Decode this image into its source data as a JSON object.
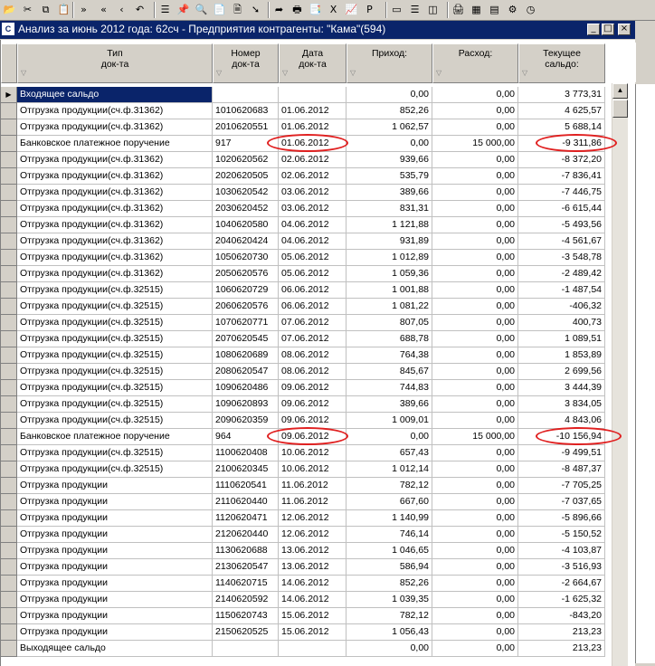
{
  "title": "Анализ за июнь 2012 года: 62сч - Предприятия контрагенты: \"Кама\"(594)",
  "toolbar": {
    "icons": [
      "open-icon",
      "cut-icon",
      "copy-icon",
      "paste-icon",
      "forward-icon",
      "back-icon",
      "back-step-icon",
      "undo-icon",
      "list-icon",
      "pin-icon",
      "print-preview-icon",
      "new-doc-icon",
      "doc-icon",
      "arrow-icon",
      "export-icon",
      "print-icon",
      "report-icon",
      "excel-icon",
      "excel-chart-icon",
      "pdf-icon",
      "window-icon",
      "split-h-icon",
      "split-v-icon",
      "printer-icon",
      "table-icon",
      "sheet-icon",
      "settings-icon",
      "clock-icon"
    ],
    "glyphs": [
      "📂",
      "✂",
      "⧉",
      "📋",
      "»",
      "«",
      "‹",
      "↶",
      "☰",
      "📌",
      "🔍",
      "📄",
      "🗎",
      "➘",
      "➦",
      "🖶",
      "📑",
      "X",
      "📈",
      "P",
      "▭",
      "☰",
      "◫",
      "🖨",
      "▦",
      "▤",
      "⚙",
      "◷"
    ]
  },
  "window_buttons": {
    "minimize": "_",
    "maximize": "□",
    "close": "×"
  },
  "columns": [
    {
      "name": "col-doc-type",
      "label": "Тип\nдок-та"
    },
    {
      "name": "col-doc-number",
      "label": "Номер\nдок-та"
    },
    {
      "name": "col-doc-date",
      "label": "Дата\nдок-та"
    },
    {
      "name": "col-income",
      "label": "Приход:"
    },
    {
      "name": "col-expense",
      "label": "Расход:"
    },
    {
      "name": "col-balance",
      "label": "Текущее\nсальдо:"
    }
  ],
  "rows": [
    [
      "Входящее сальдо",
      "",
      "",
      "0,00",
      "0,00",
      "3 773,31"
    ],
    [
      "Отгрузка продукции(сч.ф.31362)",
      "1010620683",
      "01.06.2012",
      "852,26",
      "0,00",
      "4 625,57"
    ],
    [
      "Отгрузка продукции(сч.ф.31362)",
      "2010620551",
      "01.06.2012",
      "1 062,57",
      "0,00",
      "5 688,14"
    ],
    [
      "Банковское платежное поручение",
      "917",
      "01.06.2012",
      "0,00",
      "15 000,00",
      "-9 311,86"
    ],
    [
      "Отгрузка продукции(сч.ф.31362)",
      "1020620562",
      "02.06.2012",
      "939,66",
      "0,00",
      "-8 372,20"
    ],
    [
      "Отгрузка продукции(сч.ф.31362)",
      "2020620505",
      "02.06.2012",
      "535,79",
      "0,00",
      "-7 836,41"
    ],
    [
      "Отгрузка продукции(сч.ф.31362)",
      "1030620542",
      "03.06.2012",
      "389,66",
      "0,00",
      "-7 446,75"
    ],
    [
      "Отгрузка продукции(сч.ф.31362)",
      "2030620452",
      "03.06.2012",
      "831,31",
      "0,00",
      "-6 615,44"
    ],
    [
      "Отгрузка продукции(сч.ф.31362)",
      "1040620580",
      "04.06.2012",
      "1 121,88",
      "0,00",
      "-5 493,56"
    ],
    [
      "Отгрузка продукции(сч.ф.31362)",
      "2040620424",
      "04.06.2012",
      "931,89",
      "0,00",
      "-4 561,67"
    ],
    [
      "Отгрузка продукции(сч.ф.31362)",
      "1050620730",
      "05.06.2012",
      "1 012,89",
      "0,00",
      "-3 548,78"
    ],
    [
      "Отгрузка продукции(сч.ф.31362)",
      "2050620576",
      "05.06.2012",
      "1 059,36",
      "0,00",
      "-2 489,42"
    ],
    [
      "Отгрузка продукции(сч.ф.32515)",
      "1060620729",
      "06.06.2012",
      "1 001,88",
      "0,00",
      "-1 487,54"
    ],
    [
      "Отгрузка продукции(сч.ф.32515)",
      "2060620576",
      "06.06.2012",
      "1 081,22",
      "0,00",
      "-406,32"
    ],
    [
      "Отгрузка продукции(сч.ф.32515)",
      "1070620771",
      "07.06.2012",
      "807,05",
      "0,00",
      "400,73"
    ],
    [
      "Отгрузка продукции(сч.ф.32515)",
      "2070620545",
      "07.06.2012",
      "688,78",
      "0,00",
      "1 089,51"
    ],
    [
      "Отгрузка продукции(сч.ф.32515)",
      "1080620689",
      "08.06.2012",
      "764,38",
      "0,00",
      "1 853,89"
    ],
    [
      "Отгрузка продукции(сч.ф.32515)",
      "2080620547",
      "08.06.2012",
      "845,67",
      "0,00",
      "2 699,56"
    ],
    [
      "Отгрузка продукции(сч.ф.32515)",
      "1090620486",
      "09.06.2012",
      "744,83",
      "0,00",
      "3 444,39"
    ],
    [
      "Отгрузка продукции(сч.ф.32515)",
      "1090620893",
      "09.06.2012",
      "389,66",
      "0,00",
      "3 834,05"
    ],
    [
      "Отгрузка продукции(сч.ф.32515)",
      "2090620359",
      "09.06.2012",
      "1 009,01",
      "0,00",
      "4 843,06"
    ],
    [
      "Банковское платежное поручение",
      "964",
      "09.06.2012",
      "0,00",
      "15 000,00",
      "-10 156,94"
    ],
    [
      "Отгрузка продукции(сч.ф.32515)",
      "1100620408",
      "10.06.2012",
      "657,43",
      "0,00",
      "-9 499,51"
    ],
    [
      "Отгрузка продукции(сч.ф.32515)",
      "2100620345",
      "10.06.2012",
      "1 012,14",
      "0,00",
      "-8 487,37"
    ],
    [
      "Отгрузка продукции",
      "1110620541",
      "11.06.2012",
      "782,12",
      "0,00",
      "-7 705,25"
    ],
    [
      "Отгрузка продукции",
      "2110620440",
      "11.06.2012",
      "667,60",
      "0,00",
      "-7 037,65"
    ],
    [
      "Отгрузка продукции",
      "1120620471",
      "12.06.2012",
      "1 140,99",
      "0,00",
      "-5 896,66"
    ],
    [
      "Отгрузка продукции",
      "2120620440",
      "12.06.2012",
      "746,14",
      "0,00",
      "-5 150,52"
    ],
    [
      "Отгрузка продукции",
      "1130620688",
      "13.06.2012",
      "1 046,65",
      "0,00",
      "-4 103,87"
    ],
    [
      "Отгрузка продукции",
      "2130620547",
      "13.06.2012",
      "586,94",
      "0,00",
      "-3 516,93"
    ],
    [
      "Отгрузка продукции",
      "1140620715",
      "14.06.2012",
      "852,26",
      "0,00",
      "-2 664,67"
    ],
    [
      "Отгрузка продукции",
      "2140620592",
      "14.06.2012",
      "1 039,35",
      "0,00",
      "-1 625,32"
    ],
    [
      "Отгрузка продукции",
      "1150620743",
      "15.06.2012",
      "782,12",
      "0,00",
      "-843,20"
    ],
    [
      "Отгрузка продукции",
      "2150620525",
      "15.06.2012",
      "1 056,43",
      "0,00",
      "213,23"
    ],
    [
      "Выходящее сальдо",
      "",
      "",
      "0,00",
      "0,00",
      "213,23"
    ]
  ],
  "highlight_color": "#e02020",
  "selection_color": "#0a246a"
}
